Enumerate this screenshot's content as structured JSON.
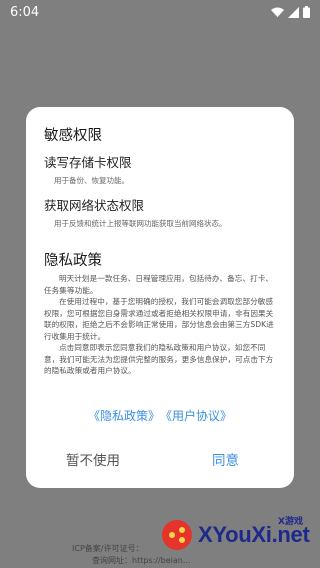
{
  "status_bar": {
    "time": "6:04"
  },
  "dialog": {
    "permissions_title": "敏感权限",
    "permissions": [
      {
        "title": "读写存储卡权限",
        "desc": "用于备份、恢复功能。"
      },
      {
        "title": "获取网络状态权限",
        "desc": "用于反馈和统计上报等联网功能获取当前网络状态。"
      }
    ],
    "privacy_title": "隐私政策",
    "privacy_paragraphs": [
      "明天计划是一款任务、日程管理应用，包括待办、备忘、打卡、任务集等功能。",
      "在使用过程中，基于您明确的授权，我们可能会调取您部分敏感权限，您可根据您自身需求通过或者拒绝相关权限申请，非有因果关联的权限，拒绝之后不会影响正常使用，部分信息会由第三方SDK进行收集用于统计。",
      "点击同意即表示您同意我们的隐私政策和用户协议，如您不同意，我们可能无法为您提供完整的服务，更多信息保护，可点击下方的隐私政策或者用户协议。"
    ],
    "privacy_link": "《隐私政策》",
    "terms_link": "《用户协议》",
    "decline_label": "暂不使用",
    "agree_label": "同意"
  },
  "footer": {
    "icp_line": "ICP备案/许可证号：",
    "website_line": "查询网址：https://beian..."
  },
  "watermark": {
    "text": "XYouXi.net",
    "tag": "X游戏"
  }
}
